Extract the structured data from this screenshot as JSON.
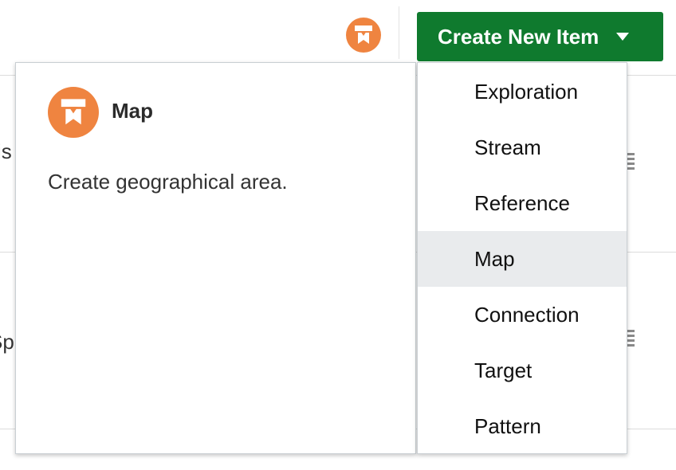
{
  "header": {
    "avatar_icon": "map-icon",
    "create_button_label": "Create New Item",
    "create_button_color": "#0f7a2e"
  },
  "background_rows": [
    {
      "fragment": "is"
    },
    {
      "fragment": "Sp"
    }
  ],
  "description_panel": {
    "icon": "map-icon",
    "icon_color": "#ef8440",
    "title": "Map",
    "text": "Create geographical area."
  },
  "menu": {
    "selected": "Map",
    "items": [
      {
        "label": "Exploration"
      },
      {
        "label": "Stream"
      },
      {
        "label": "Reference"
      },
      {
        "label": "Map"
      },
      {
        "label": "Connection"
      },
      {
        "label": "Target"
      },
      {
        "label": "Pattern"
      }
    ]
  }
}
